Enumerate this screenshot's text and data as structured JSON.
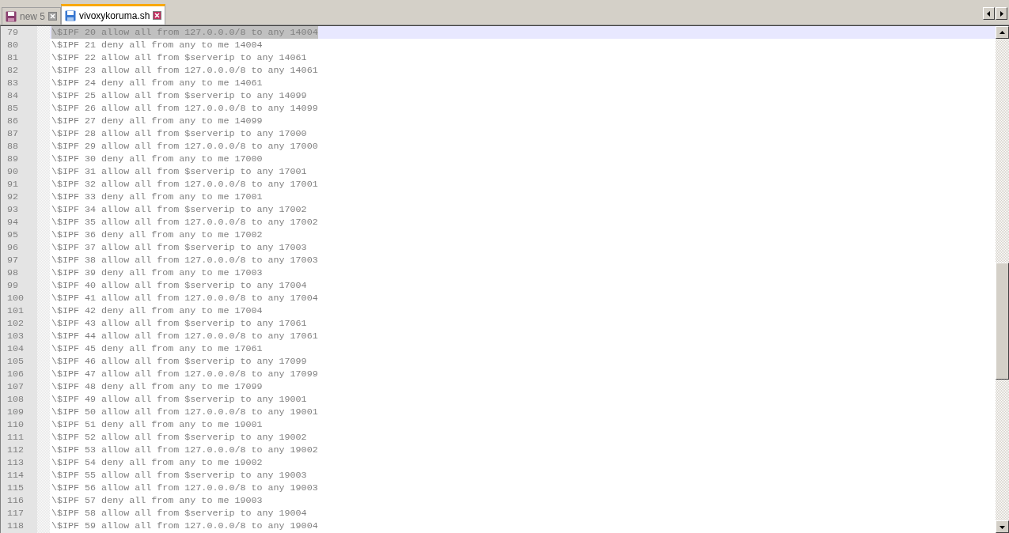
{
  "tabs": [
    {
      "label": "new 5",
      "selected": false,
      "modified": true
    },
    {
      "label": "vivoxykoruma.sh",
      "selected": true,
      "modified": false
    }
  ],
  "editor": {
    "lines": [
      {
        "number": "79",
        "text": "\\$IPF 20 allow all from 127.0.0.0/8 to any 14004",
        "selected": true
      },
      {
        "number": "80",
        "text": "\\$IPF 21 deny all from any to me 14004",
        "selected": false
      },
      {
        "number": "81",
        "text": "\\$IPF 22 allow all from $serverip to any 14061",
        "selected": false
      },
      {
        "number": "82",
        "text": "\\$IPF 23 allow all from 127.0.0.0/8 to any 14061",
        "selected": false
      },
      {
        "number": "83",
        "text": "\\$IPF 24 deny all from any to me 14061",
        "selected": false
      },
      {
        "number": "84",
        "text": "\\$IPF 25 allow all from $serverip to any 14099",
        "selected": false
      },
      {
        "number": "85",
        "text": "\\$IPF 26 allow all from 127.0.0.0/8 to any 14099",
        "selected": false
      },
      {
        "number": "86",
        "text": "\\$IPF 27 deny all from any to me 14099",
        "selected": false
      },
      {
        "number": "87",
        "text": "\\$IPF 28 allow all from $serverip to any 17000",
        "selected": false
      },
      {
        "number": "88",
        "text": "\\$IPF 29 allow all from 127.0.0.0/8 to any 17000",
        "selected": false
      },
      {
        "number": "89",
        "text": "\\$IPF 30 deny all from any to me 17000",
        "selected": false
      },
      {
        "number": "90",
        "text": "\\$IPF 31 allow all from $serverip to any 17001",
        "selected": false
      },
      {
        "number": "91",
        "text": "\\$IPF 32 allow all from 127.0.0.0/8 to any 17001",
        "selected": false
      },
      {
        "number": "92",
        "text": "\\$IPF 33 deny all from any to me 17001",
        "selected": false
      },
      {
        "number": "93",
        "text": "\\$IPF 34 allow all from $serverip to any 17002",
        "selected": false
      },
      {
        "number": "94",
        "text": "\\$IPF 35 allow all from 127.0.0.0/8 to any 17002",
        "selected": false
      },
      {
        "number": "95",
        "text": "\\$IPF 36 deny all from any to me 17002",
        "selected": false
      },
      {
        "number": "96",
        "text": "\\$IPF 37 allow all from $serverip to any 17003",
        "selected": false
      },
      {
        "number": "97",
        "text": "\\$IPF 38 allow all from 127.0.0.0/8 to any 17003",
        "selected": false
      },
      {
        "number": "98",
        "text": "\\$IPF 39 deny all from any to me 17003",
        "selected": false
      },
      {
        "number": "99",
        "text": "\\$IPF 40 allow all from $serverip to any 17004",
        "selected": false
      },
      {
        "number": "100",
        "text": "\\$IPF 41 allow all from 127.0.0.0/8 to any 17004",
        "selected": false
      },
      {
        "number": "101",
        "text": "\\$IPF 42 deny all from any to me 17004",
        "selected": false
      },
      {
        "number": "102",
        "text": "\\$IPF 43 allow all from $serverip to any 17061",
        "selected": false
      },
      {
        "number": "103",
        "text": "\\$IPF 44 allow all from 127.0.0.0/8 to any 17061",
        "selected": false
      },
      {
        "number": "104",
        "text": "\\$IPF 45 deny all from any to me 17061",
        "selected": false
      },
      {
        "number": "105",
        "text": "\\$IPF 46 allow all from $serverip to any 17099",
        "selected": false
      },
      {
        "number": "106",
        "text": "\\$IPF 47 allow all from 127.0.0.0/8 to any 17099",
        "selected": false
      },
      {
        "number": "107",
        "text": "\\$IPF 48 deny all from any to me 17099",
        "selected": false
      },
      {
        "number": "108",
        "text": "\\$IPF 49 allow all from $serverip to any 19001",
        "selected": false
      },
      {
        "number": "109",
        "text": "\\$IPF 50 allow all from 127.0.0.0/8 to any 19001",
        "selected": false
      },
      {
        "number": "110",
        "text": "\\$IPF 51 deny all from any to me 19001",
        "selected": false
      },
      {
        "number": "111",
        "text": "\\$IPF 52 allow all from $serverip to any 19002",
        "selected": false
      },
      {
        "number": "112",
        "text": "\\$IPF 53 allow all from 127.0.0.0/8 to any 19002",
        "selected": false
      },
      {
        "number": "113",
        "text": "\\$IPF 54 deny all from any to me 19002",
        "selected": false
      },
      {
        "number": "114",
        "text": "\\$IPF 55 allow all from $serverip to any 19003",
        "selected": false
      },
      {
        "number": "115",
        "text": "\\$IPF 56 allow all from 127.0.0.0/8 to any 19003",
        "selected": false
      },
      {
        "number": "116",
        "text": "\\$IPF 57 deny all from any to me 19003",
        "selected": false
      },
      {
        "number": "117",
        "text": "\\$IPF 58 allow all from $serverip to any 19004",
        "selected": false
      },
      {
        "number": "118",
        "text": "\\$IPF 59 allow all from 127.0.0.0/8 to any 19004",
        "selected": false
      }
    ]
  }
}
